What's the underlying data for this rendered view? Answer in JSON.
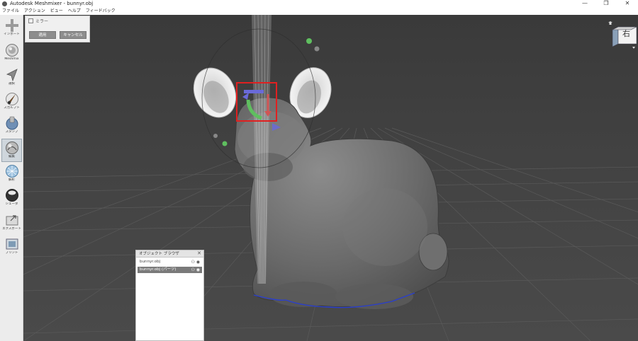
{
  "window": {
    "title": "Autodesk Meshmixer - bunnyr.obj",
    "controls": {
      "minimize": "—",
      "restore": "❐",
      "close": "✕"
    }
  },
  "menu": [
    "ファイル",
    "アクション",
    "ビュー",
    "ヘルプ",
    "フィードバック"
  ],
  "toolbar": [
    {
      "label": "インポート",
      "icon": "plus-icon"
    },
    {
      "label": "Meshmix",
      "icon": "meshmix-icon"
    },
    {
      "label": "選択",
      "icon": "select-arrow-icon"
    },
    {
      "label": "スカルプト",
      "icon": "brush-icon"
    },
    {
      "label": "スタンプ",
      "icon": "stamp-icon"
    },
    {
      "label": "編集",
      "icon": "edit-sphere-icon",
      "active": true
    },
    {
      "label": "解析",
      "icon": "analysis-sphere-icon"
    },
    {
      "label": "シェーダ",
      "icon": "shader-sphere-icon"
    },
    {
      "label": "エクスポート",
      "icon": "export-icon"
    },
    {
      "label": "プリント",
      "icon": "print-icon"
    }
  ],
  "mirror_panel": {
    "title": "ミラー",
    "apply_label": "適用",
    "cancel_label": "キャンセル"
  },
  "viewcube": {
    "face_label": "右"
  },
  "object_browser": {
    "title": "オブジェクト ブラウザ",
    "close": "✕",
    "items": [
      {
        "name": "bunnyr.obj",
        "selected": false
      },
      {
        "name": "bunnyr.obj (パーツ)",
        "selected": true
      }
    ]
  },
  "colors": {
    "viewport_bg": "#444444",
    "gizmo_green": "#5fbf5f",
    "gizmo_blue": "#6a6ad8",
    "gizmo_red": "#d05555",
    "highlight_box": "#e02020",
    "boundary_blue": "#2a3fd0"
  }
}
